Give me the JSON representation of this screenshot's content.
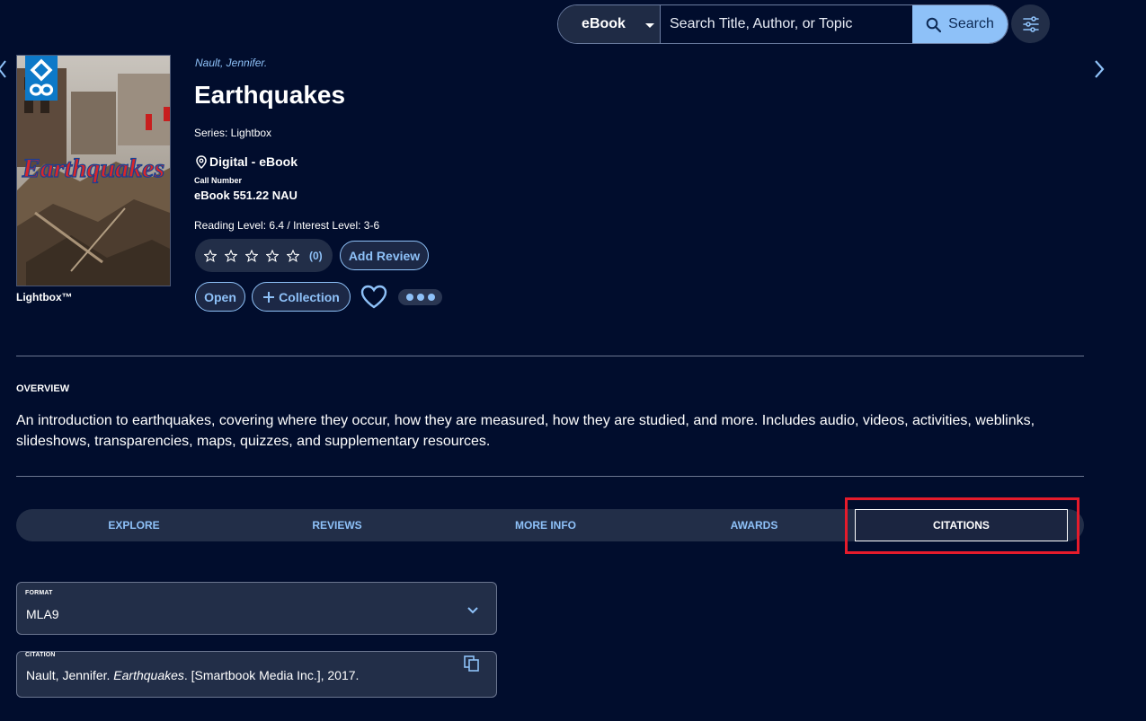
{
  "search": {
    "format": "eBook",
    "placeholder": "Search Title, Author, or Topic",
    "button_label": "Search"
  },
  "book": {
    "cover_caption": "Lightbox™",
    "cover_text": "Earthquakes",
    "author": "Nault, Jennifer.",
    "title": "Earthquakes",
    "series": "Series: Lightbox",
    "format": "Digital - eBook",
    "call_number_label": "Call Number",
    "call_number": "eBook 551.22 NAU",
    "reading_level": "Reading Level: 6.4 / Interest Level: 3-6",
    "rating_count": "(0)",
    "stars": 0
  },
  "actions": {
    "add_review": "Add Review",
    "open": "Open",
    "collection": "Collection"
  },
  "overview": {
    "label": "OVERVIEW",
    "text": "An introduction to earthquakes, covering where they occur, how they are measured, how they are studied, and more. Includes audio, videos, activities, weblinks, slideshows, transparencies, maps, quizzes, and supplementary resources."
  },
  "tabs": [
    {
      "label": "EXPLORE"
    },
    {
      "label": "REVIEWS"
    },
    {
      "label": "MORE INFO"
    },
    {
      "label": "AWARDS"
    },
    {
      "label": "CITATIONS"
    }
  ],
  "citation": {
    "format_label": "FORMAT",
    "format_value": "MLA9",
    "citation_label": "CITATION",
    "author": "Nault, Jennifer.",
    "title": "Earthquakes",
    "rest": ". [Smartbook Media Inc.], 2017."
  },
  "colors": {
    "background": "#010d2d",
    "accent": "#8ec1f8",
    "highlight": "#e51b2b"
  }
}
